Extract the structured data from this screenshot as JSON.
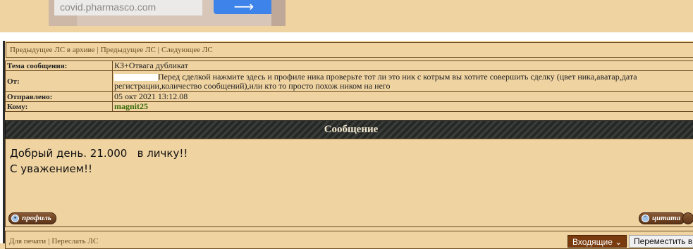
{
  "ad": {
    "url": "covid.pharmasco.com",
    "go_icon": "arrow-right-icon"
  },
  "nav": {
    "prev_archive": "Предыдущее ЛС в архиве",
    "prev": "Предыдущее ЛС",
    "next": "Следующее ЛС",
    "separator": "|"
  },
  "info": {
    "subject_label": "Тема сообщения:",
    "subject_value": "КЗ+Отвага дубликат",
    "from_label": "От:",
    "from_value": "Перед сделкой нажмите здесь и профиле ника проверьте тот ли это ник с котрым вы хотите совершить сделку (цвет ника,аватар,дата регистрации,количество сообщений),или кто то просто похож ником на него",
    "sent_label": "Отправлено:",
    "sent_value": "05 окт 2021 13:12.08",
    "to_label": "Кому:",
    "to_value": "magnit25"
  },
  "message": {
    "header": "Сообщение",
    "line1": "Добрый день. 21.000   в личку!!",
    "line2": "С уважением!!"
  },
  "buttons": {
    "profile": "профиль",
    "quote": "цитата"
  },
  "footer": {
    "print": "Для печати",
    "forward": "Переслать ЛС",
    "folder_select": "Входящие",
    "move": "Переместить в"
  }
}
